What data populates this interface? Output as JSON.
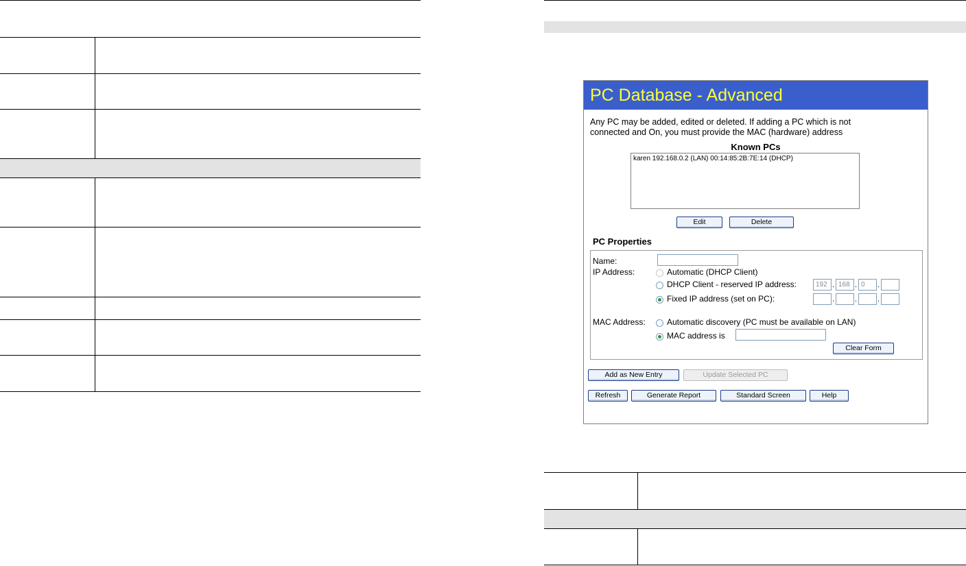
{
  "screenshot": {
    "title": "PC Database - Advanced",
    "intro_line1": "Any PC may be added, edited or deleted. If adding a PC which is not",
    "intro_line2": "connected and On, you must provide the MAC (hardware) address",
    "known_pcs": {
      "heading": "Known PCs",
      "items": [
        "karen 192.168.0.2 (LAN) 00:14:85:2B:7E:14 (DHCP)"
      ]
    },
    "list_buttons": {
      "edit": "Edit",
      "delete": "Delete"
    },
    "pc_properties": {
      "heading": "PC Properties",
      "name_label": "Name:",
      "name_value": "",
      "ip_label": "IP Address:",
      "ip_options": {
        "automatic": "Automatic (DHCP Client)",
        "reserved": "DHCP Client - reserved IP address:",
        "fixed": "Fixed IP address (set on PC):"
      },
      "ip_selected": "fixed",
      "reserved_ip": [
        "192",
        "168",
        "0",
        ""
      ],
      "fixed_ip": [
        "",
        "",
        "",
        ""
      ],
      "mac_label": "MAC Address:",
      "mac_options": {
        "auto": "Automatic discovery (PC must be available on LAN)",
        "manual": "MAC address is"
      },
      "mac_selected": "manual",
      "mac_value": "",
      "clear_button": "Clear Form"
    },
    "action_buttons": {
      "add": "Add as New Entry",
      "update": "Update Selected PC",
      "refresh": "Refresh",
      "report": "Generate Report",
      "standard": "Standard Screen",
      "help": "Help"
    },
    "colors": {
      "title_bg": "#3a5fcd",
      "title_fg": "#ffff33"
    }
  }
}
